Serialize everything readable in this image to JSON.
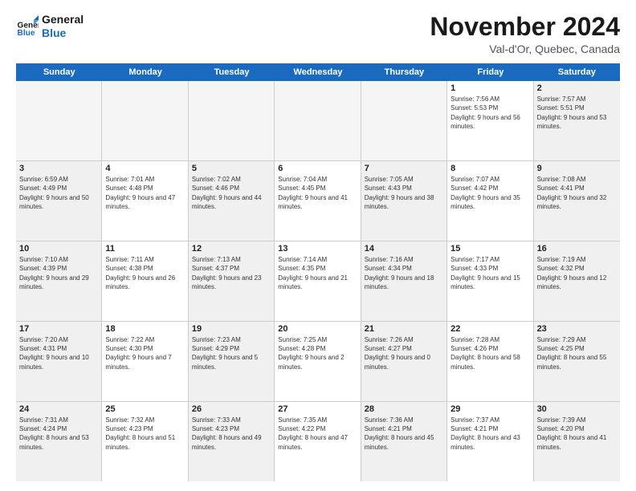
{
  "logo": {
    "line1": "General",
    "line2": "Blue"
  },
  "title": "November 2024",
  "subtitle": "Val-d'Or, Quebec, Canada",
  "days_of_week": [
    "Sunday",
    "Monday",
    "Tuesday",
    "Wednesday",
    "Thursday",
    "Friday",
    "Saturday"
  ],
  "weeks": [
    [
      {
        "day": "",
        "info": "",
        "empty": true
      },
      {
        "day": "",
        "info": "",
        "empty": true
      },
      {
        "day": "",
        "info": "",
        "empty": true
      },
      {
        "day": "",
        "info": "",
        "empty": true
      },
      {
        "day": "",
        "info": "",
        "empty": true
      },
      {
        "day": "1",
        "info": "Sunrise: 7:56 AM\nSunset: 5:53 PM\nDaylight: 9 hours and 56 minutes."
      },
      {
        "day": "2",
        "info": "Sunrise: 7:57 AM\nSunset: 5:51 PM\nDaylight: 9 hours and 53 minutes."
      }
    ],
    [
      {
        "day": "3",
        "info": "Sunrise: 6:59 AM\nSunset: 4:49 PM\nDaylight: 9 hours and 50 minutes."
      },
      {
        "day": "4",
        "info": "Sunrise: 7:01 AM\nSunset: 4:48 PM\nDaylight: 9 hours and 47 minutes."
      },
      {
        "day": "5",
        "info": "Sunrise: 7:02 AM\nSunset: 4:46 PM\nDaylight: 9 hours and 44 minutes."
      },
      {
        "day": "6",
        "info": "Sunrise: 7:04 AM\nSunset: 4:45 PM\nDaylight: 9 hours and 41 minutes."
      },
      {
        "day": "7",
        "info": "Sunrise: 7:05 AM\nSunset: 4:43 PM\nDaylight: 9 hours and 38 minutes."
      },
      {
        "day": "8",
        "info": "Sunrise: 7:07 AM\nSunset: 4:42 PM\nDaylight: 9 hours and 35 minutes."
      },
      {
        "day": "9",
        "info": "Sunrise: 7:08 AM\nSunset: 4:41 PM\nDaylight: 9 hours and 32 minutes."
      }
    ],
    [
      {
        "day": "10",
        "info": "Sunrise: 7:10 AM\nSunset: 4:39 PM\nDaylight: 9 hours and 29 minutes."
      },
      {
        "day": "11",
        "info": "Sunrise: 7:11 AM\nSunset: 4:38 PM\nDaylight: 9 hours and 26 minutes."
      },
      {
        "day": "12",
        "info": "Sunrise: 7:13 AM\nSunset: 4:37 PM\nDaylight: 9 hours and 23 minutes."
      },
      {
        "day": "13",
        "info": "Sunrise: 7:14 AM\nSunset: 4:35 PM\nDaylight: 9 hours and 21 minutes."
      },
      {
        "day": "14",
        "info": "Sunrise: 7:16 AM\nSunset: 4:34 PM\nDaylight: 9 hours and 18 minutes."
      },
      {
        "day": "15",
        "info": "Sunrise: 7:17 AM\nSunset: 4:33 PM\nDaylight: 9 hours and 15 minutes."
      },
      {
        "day": "16",
        "info": "Sunrise: 7:19 AM\nSunset: 4:32 PM\nDaylight: 9 hours and 12 minutes."
      }
    ],
    [
      {
        "day": "17",
        "info": "Sunrise: 7:20 AM\nSunset: 4:31 PM\nDaylight: 9 hours and 10 minutes."
      },
      {
        "day": "18",
        "info": "Sunrise: 7:22 AM\nSunset: 4:30 PM\nDaylight: 9 hours and 7 minutes."
      },
      {
        "day": "19",
        "info": "Sunrise: 7:23 AM\nSunset: 4:29 PM\nDaylight: 9 hours and 5 minutes."
      },
      {
        "day": "20",
        "info": "Sunrise: 7:25 AM\nSunset: 4:28 PM\nDaylight: 9 hours and 2 minutes."
      },
      {
        "day": "21",
        "info": "Sunrise: 7:26 AM\nSunset: 4:27 PM\nDaylight: 9 hours and 0 minutes."
      },
      {
        "day": "22",
        "info": "Sunrise: 7:28 AM\nSunset: 4:26 PM\nDaylight: 8 hours and 58 minutes."
      },
      {
        "day": "23",
        "info": "Sunrise: 7:29 AM\nSunset: 4:25 PM\nDaylight: 8 hours and 55 minutes."
      }
    ],
    [
      {
        "day": "24",
        "info": "Sunrise: 7:31 AM\nSunset: 4:24 PM\nDaylight: 8 hours and 53 minutes."
      },
      {
        "day": "25",
        "info": "Sunrise: 7:32 AM\nSunset: 4:23 PM\nDaylight: 8 hours and 51 minutes."
      },
      {
        "day": "26",
        "info": "Sunrise: 7:33 AM\nSunset: 4:23 PM\nDaylight: 8 hours and 49 minutes."
      },
      {
        "day": "27",
        "info": "Sunrise: 7:35 AM\nSunset: 4:22 PM\nDaylight: 8 hours and 47 minutes."
      },
      {
        "day": "28",
        "info": "Sunrise: 7:36 AM\nSunset: 4:21 PM\nDaylight: 8 hours and 45 minutes."
      },
      {
        "day": "29",
        "info": "Sunrise: 7:37 AM\nSunset: 4:21 PM\nDaylight: 8 hours and 43 minutes."
      },
      {
        "day": "30",
        "info": "Sunrise: 7:39 AM\nSunset: 4:20 PM\nDaylight: 8 hours and 41 minutes."
      }
    ]
  ]
}
